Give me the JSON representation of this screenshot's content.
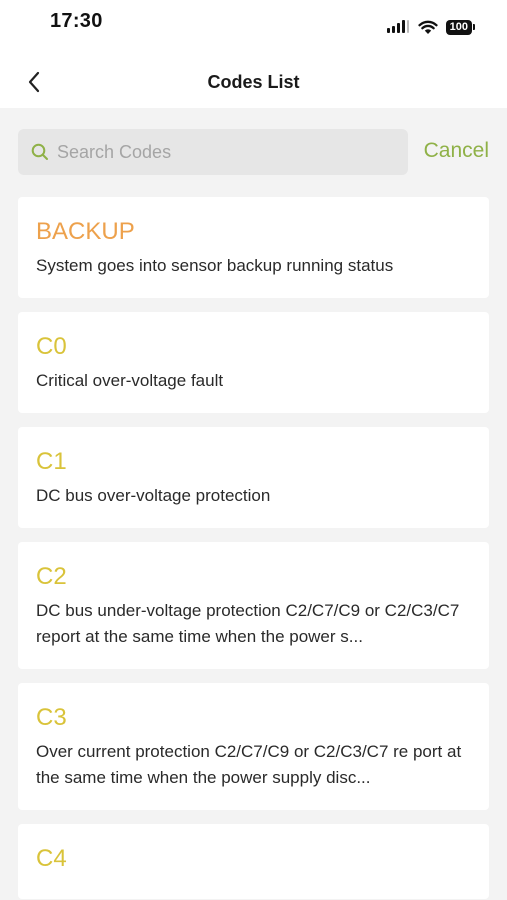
{
  "status_bar": {
    "time": "17:30",
    "battery": "100"
  },
  "nav": {
    "title": "Codes List"
  },
  "search": {
    "placeholder": "Search Codes",
    "value": "",
    "cancel_label": "Cancel"
  },
  "colors": {
    "accent_green": "#8fb147",
    "code_yellow": "#d9c33a",
    "backup_orange": "#eda14c"
  },
  "codes": [
    {
      "code": "BACKUP",
      "description": "System goes into sensor backup running status"
    },
    {
      "code": "C0",
      "description": "Critical over-voltage fault"
    },
    {
      "code": "C1",
      "description": "DC bus over-voltage protection"
    },
    {
      "code": "C2",
      "description": "DC bus under-voltage protection C2/C7/C9 or C2/C3/C7 report at the same time when the power s..."
    },
    {
      "code": "C3",
      "description": "Over current protection C2/C7/C9 or C2/C3/C7 re port at the same time when the power supply disc..."
    },
    {
      "code": "C4",
      "description": ""
    }
  ]
}
